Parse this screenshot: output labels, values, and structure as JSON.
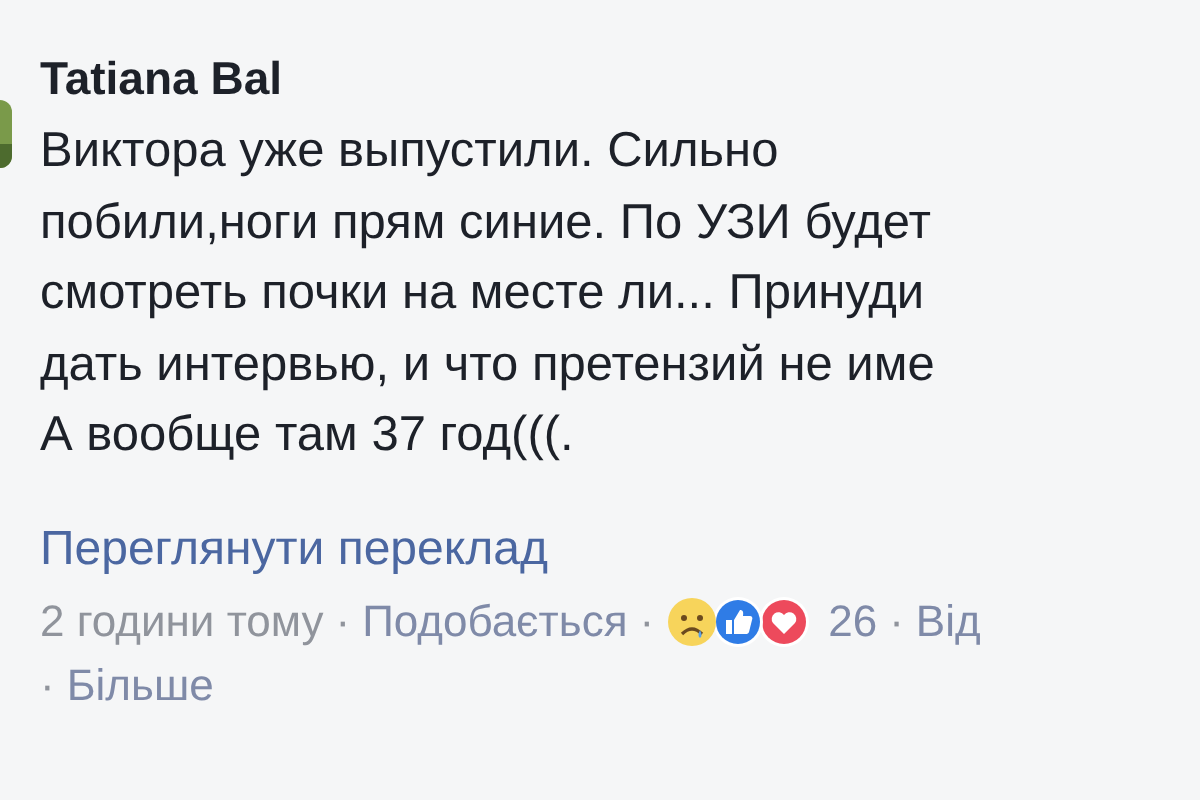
{
  "comment": {
    "kind": "picture",
    "author": "Tatiana Bal",
    "text": "Виктора уже выпустили. Сильно\nпобили,ноги прям синие. По УЗИ будет\nсмотреть почки на месте ли... Принуди\nдать интервью, и что претензий не име\nА вообще там 37 год(((.",
    "translate_link": "Переглянути переклад",
    "time": "2 години тому",
    "like_link": "Подобається",
    "reactions": [
      {
        "kind": "sad"
      },
      {
        "kind": "like"
      },
      {
        "kind": "love"
      }
    ],
    "reaction_count": "26",
    "reply_link": "Від",
    "more_link": "Більше",
    "separator": "·"
  }
}
